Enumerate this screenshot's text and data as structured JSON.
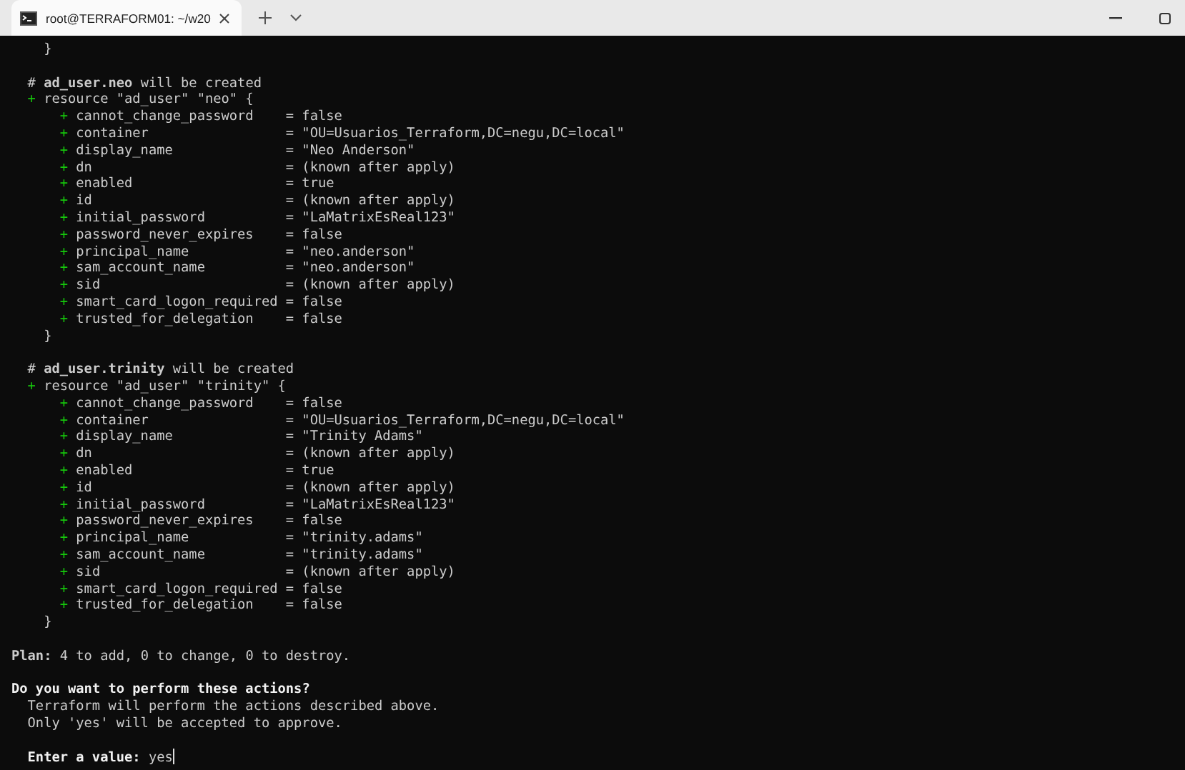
{
  "tabs": [
    {
      "title": "root@TERRAFORM01: ~/w20",
      "selected": true
    }
  ],
  "terminal": {
    "leading_line": "}",
    "resources": [
      {
        "comment": "# **ad_user.neo** will be created",
        "sign": "+",
        "header": "resource \"ad_user\" \"neo\" {",
        "attributes": [
          {
            "sign": "+",
            "name": "cannot_change_password",
            "value": "= false"
          },
          {
            "sign": "+",
            "name": "container",
            "value": "= \"OU=Usuarios_Terraform,DC=negu,DC=local\""
          },
          {
            "sign": "+",
            "name": "display_name",
            "value": "= \"Neo Anderson\""
          },
          {
            "sign": "+",
            "name": "dn",
            "value": "= (known after apply)"
          },
          {
            "sign": "+",
            "name": "enabled",
            "value": "= true"
          },
          {
            "sign": "+",
            "name": "id",
            "value": "= (known after apply)"
          },
          {
            "sign": "+",
            "name": "initial_password",
            "value": "= \"LaMatrixEsReal123\""
          },
          {
            "sign": "+",
            "name": "password_never_expires",
            "value": "= false"
          },
          {
            "sign": "+",
            "name": "principal_name",
            "value": "= \"neo.anderson\""
          },
          {
            "sign": "+",
            "name": "sam_account_name",
            "value": "= \"neo.anderson\""
          },
          {
            "sign": "+",
            "name": "sid",
            "value": "= (known after apply)"
          },
          {
            "sign": "+",
            "name": "smart_card_logon_required",
            "value": "= false"
          },
          {
            "sign": "+",
            "name": "trusted_for_delegation",
            "value": "= false"
          }
        ],
        "close": "}"
      },
      {
        "comment": "# **ad_user.trinity** will be created",
        "sign": "+",
        "header": "resource \"ad_user\" \"trinity\" {",
        "attributes": [
          {
            "sign": "+",
            "name": "cannot_change_password",
            "value": "= false"
          },
          {
            "sign": "+",
            "name": "container",
            "value": "= \"OU=Usuarios_Terraform,DC=negu,DC=local\""
          },
          {
            "sign": "+",
            "name": "display_name",
            "value": "= \"Trinity Adams\""
          },
          {
            "sign": "+",
            "name": "dn",
            "value": "= (known after apply)"
          },
          {
            "sign": "+",
            "name": "enabled",
            "value": "= true"
          },
          {
            "sign": "+",
            "name": "id",
            "value": "= (known after apply)"
          },
          {
            "sign": "+",
            "name": "initial_password",
            "value": "= \"LaMatrixEsReal123\""
          },
          {
            "sign": "+",
            "name": "password_never_expires",
            "value": "= false"
          },
          {
            "sign": "+",
            "name": "principal_name",
            "value": "= \"trinity.adams\""
          },
          {
            "sign": "+",
            "name": "sam_account_name",
            "value": "= \"trinity.adams\""
          },
          {
            "sign": "+",
            "name": "sid",
            "value": "= (known after apply)"
          },
          {
            "sign": "+",
            "name": "smart_card_logon_required",
            "value": "= false"
          },
          {
            "sign": "+",
            "name": "trusted_for_delegation",
            "value": "= false"
          }
        ],
        "close": "}"
      }
    ],
    "plan": "**Plan:** 4 to add, 0 to change, 0 to destroy.",
    "question": "Do you want to perform these actions?",
    "notes": [
      "Terraform will perform the actions described above.",
      "Only 'yes' will be accepted to approve."
    ],
    "prompt": {
      "label": "Enter a value:",
      "value": "yes"
    }
  }
}
